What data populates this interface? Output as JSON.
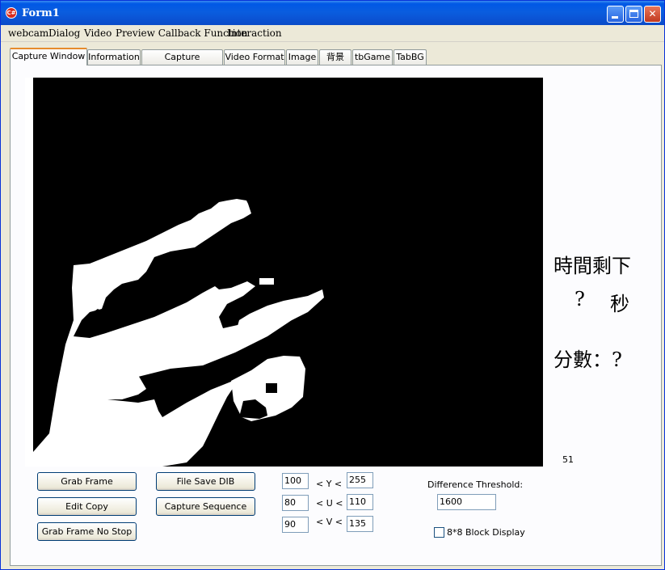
{
  "window": {
    "title": "Form1",
    "controls": [
      "minimize",
      "maximize",
      "close"
    ]
  },
  "menu": [
    "webcam",
    "Dialog",
    "Video",
    "Preview Callback Function",
    "Interaction"
  ],
  "tabs": [
    {
      "label": "Capture Window",
      "active": true
    },
    {
      "label": "Information"
    },
    {
      "label": "Capture Parameter"
    },
    {
      "label": "Video Format"
    },
    {
      "label": "Image"
    },
    {
      "label": "背景"
    },
    {
      "label": "tbGame"
    },
    {
      "label": "TabBG"
    }
  ],
  "game": {
    "time_label": "時間剩下",
    "time_value": "?",
    "time_unit": "秒",
    "score_label": "分數：?",
    "counter": "51"
  },
  "buttons": {
    "grab_frame": "Grab Frame",
    "edit_copy": "Edit Copy",
    "grab_no_stop": "Grab Frame No Stop",
    "file_save_dib": "File Save DIB",
    "capture_sequence": "Capture Sequence"
  },
  "yuv": {
    "y_label": "< Y <",
    "y_min": "100",
    "y_max": "255",
    "u_label": "< U <",
    "u_min": "80",
    "u_max": "110",
    "v_label": "< V <",
    "v_min": "90",
    "v_max": "135"
  },
  "threshold": {
    "label": "Difference Threshold:",
    "value": "1600"
  },
  "block_display": {
    "label": "8*8 Block Display",
    "checked": false
  },
  "colors": {
    "titlebar": "#0a5ddf",
    "tab_accent": "#e68b2c",
    "face": "#ece9d8"
  }
}
